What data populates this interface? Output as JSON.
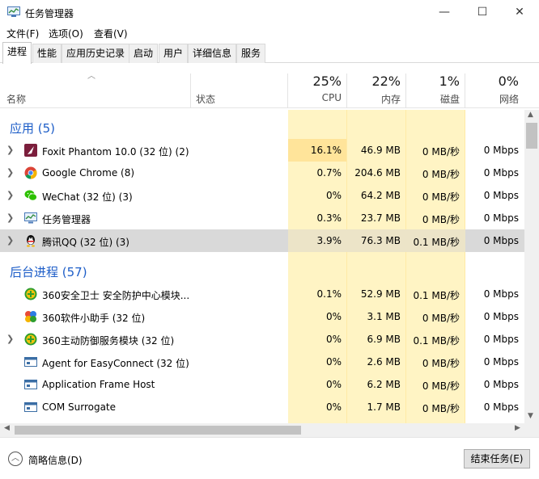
{
  "window": {
    "title": "任务管理器",
    "minimize": "—",
    "maximize": "☐",
    "close": "✕"
  },
  "menu": [
    "文件(F)",
    "选项(O)",
    "查看(V)"
  ],
  "tabs": [
    "进程",
    "性能",
    "应用历史记录",
    "启动",
    "用户",
    "详细信息",
    "服务"
  ],
  "columns": {
    "name": "名称",
    "status": "状态",
    "cpu": {
      "pct": "25%",
      "label": "CPU"
    },
    "memory": {
      "pct": "22%",
      "label": "内存"
    },
    "disk": {
      "pct": "1%",
      "label": "磁盘"
    },
    "network": {
      "pct": "0%",
      "label": "网络"
    }
  },
  "groups": {
    "apps": "应用 (5)",
    "background": "后台进程 (57)"
  },
  "apps": [
    {
      "name": "Foxit Phantom 10.0 (32 位) (2)",
      "cpu": "16.1%",
      "mem": "46.9 MB",
      "disk": "0 MB/秒",
      "net": "0 Mbps",
      "icon": "foxit-icon"
    },
    {
      "name": "Google Chrome (8)",
      "cpu": "0.7%",
      "mem": "204.6 MB",
      "disk": "0 MB/秒",
      "net": "0 Mbps",
      "icon": "chrome-icon"
    },
    {
      "name": "WeChat (32 位) (3)",
      "cpu": "0%",
      "mem": "64.2 MB",
      "disk": "0 MB/秒",
      "net": "0 Mbps",
      "icon": "wechat-icon"
    },
    {
      "name": "任务管理器",
      "cpu": "0.3%",
      "mem": "23.7 MB",
      "disk": "0 MB/秒",
      "net": "0 Mbps",
      "icon": "task-manager-icon"
    },
    {
      "name": "腾讯QQ (32 位) (3)",
      "cpu": "3.9%",
      "mem": "76.3 MB",
      "disk": "0.1 MB/秒",
      "net": "0 Mbps",
      "icon": "qq-icon"
    }
  ],
  "background": [
    {
      "name": "360安全卫士 安全防护中心模块...",
      "cpu": "0.1%",
      "mem": "52.9 MB",
      "disk": "0.1 MB/秒",
      "net": "0 Mbps",
      "icon": "360-icon"
    },
    {
      "name": "360软件小助手 (32 位)",
      "cpu": "0%",
      "mem": "3.1 MB",
      "disk": "0 MB/秒",
      "net": "0 Mbps",
      "icon": "360-helper-icon"
    },
    {
      "name": "360主动防御服务模块 (32 位)",
      "cpu": "0%",
      "mem": "6.9 MB",
      "disk": "0.1 MB/秒",
      "net": "0 Mbps",
      "icon": "360-icon"
    },
    {
      "name": "Agent for EasyConnect (32 位)",
      "cpu": "0%",
      "mem": "2.6 MB",
      "disk": "0 MB/秒",
      "net": "0 Mbps",
      "icon": "window-icon"
    },
    {
      "name": "Application Frame Host",
      "cpu": "0%",
      "mem": "6.2 MB",
      "disk": "0 MB/秒",
      "net": "0 Mbps",
      "icon": "window-icon"
    },
    {
      "name": "COM Surrogate",
      "cpu": "0%",
      "mem": "1.7 MB",
      "disk": "0 MB/秒",
      "net": "0 Mbps",
      "icon": "window-icon"
    }
  ],
  "footer": {
    "fewer_details": "简略信息(D)",
    "end_task": "结束任务(E)"
  }
}
